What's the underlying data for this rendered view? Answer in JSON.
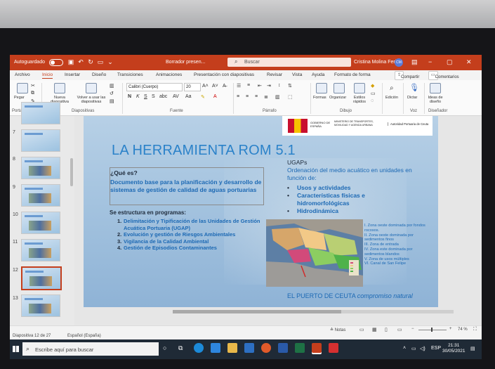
{
  "titlebar": {
    "autosave_label": "Autoguardado",
    "doc_title": "Borrador presen...",
    "search_placeholder": "Buscar",
    "user_name": "Cristina Molina Feria",
    "user_initials": "CM",
    "accent_color": "#c43e1c"
  },
  "ribbon_tabs": [
    "Archivo",
    "Inicio",
    "Insertar",
    "Diseño",
    "Transiciones",
    "Animaciones",
    "Presentación con diapositivas",
    "Revisar",
    "Vista",
    "Ayuda",
    "Formato de forma"
  ],
  "ribbon_actions": {
    "share": "Compartir",
    "comments": "Comentarios"
  },
  "ribbon": {
    "clipboard": {
      "paste": "Pegar",
      "group": "Portapapeles"
    },
    "slides": {
      "new_slide": "Nueva diapositiva",
      "reuse": "Volver a usar las diapositivas",
      "group": "Diapositivas"
    },
    "font": {
      "family": "Calibri (Cuerpo)",
      "size": "20",
      "group": "Fuente"
    },
    "paragraph": {
      "group": "Párrafo"
    },
    "drawing": {
      "shapes": "Formas",
      "arrange": "Organizar",
      "quick_styles": "Estilos rápidos",
      "group": "Dibujo"
    },
    "editing": {
      "label": "Edición"
    },
    "voice": {
      "dictate": "Dictar",
      "group": "Voz"
    },
    "designer": {
      "ideas": "Ideas de diseño",
      "group": "Diseñador"
    }
  },
  "thumbnails": {
    "numbers": [
      "7",
      "8",
      "9",
      "10",
      "11",
      "12",
      "13"
    ],
    "selected": "12"
  },
  "slide": {
    "header_gov_1": "GOBIERNO DE ESPAÑA",
    "header_gov_2": "MINISTERIO DE TRANSPORTES, MOVILIDAD Y AGENDA URBANA",
    "header_port": "Autoridad Portuaria de Ceuta",
    "title": "LA HERRAMIENTA ROM 5.1",
    "question": "¿Qué es?",
    "description": "Documento base para la planificación y desarrollo de sistemas de gestión de calidad de aguas portuarias",
    "programs_heading": "Se estructura en programas:",
    "programs": [
      "Delimitación y Tipificación de las Unidades de Gestión Acuática Portuaria (UGAP)",
      "Evolución y gestión de Riesgos Ambientales",
      "Vigilancia de la Calidad Ambiental",
      "Gestión de Episodios Contaminantes"
    ],
    "program_numbers": [
      "1.",
      "2.",
      "3.",
      "4."
    ],
    "ugap_heading": "UGAPs",
    "ugap_desc": "Ordenación del medio acuático en unidades en función de:",
    "ugap_items": [
      "Usos y actividades",
      "Características físicas e hidromorfológicas",
      "Hidrodinámica"
    ],
    "zones": [
      "I. Zona oeste dominada por fondos rocosos.",
      "II. Zona oeste dominada por sedimentos finos",
      "III. Zona de entrada",
      "IV. Zona este dominada por sedimentos blandos",
      "V. Zona de usos múltiples",
      "VI. Canal de San Felipe"
    ],
    "footer_plain": "EL PUERTO DE CEUTA",
    "footer_italic": "compromiso natural"
  },
  "notes_label": "Notas",
  "status": {
    "slide_counter": "Diapositiva 12 de 27",
    "language": "Español (España)",
    "zoom": "74 %"
  },
  "taskbar": {
    "search_placeholder": "Escribe aquí para buscar",
    "time": "21:31",
    "date": "30/05/2021"
  }
}
